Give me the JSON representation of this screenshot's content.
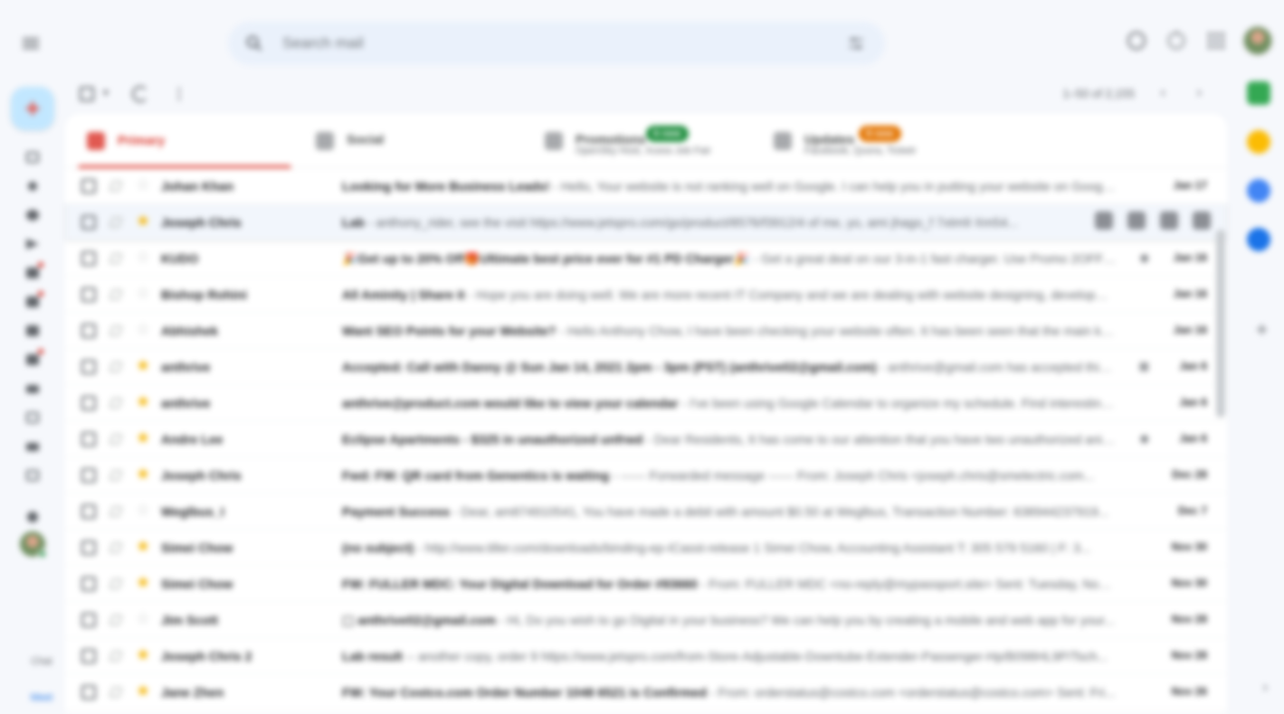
{
  "search": {
    "placeholder": "Search mail"
  },
  "toolbar": {
    "range": "1–50 of 2,155",
    "more": "⋮",
    "prev": "‹",
    "next": "›"
  },
  "rail": {
    "small_label": "Chat",
    "link_label": "Meet"
  },
  "tabs": [
    {
      "label": "Primary",
      "sub": "",
      "badge": "",
      "badge_color": "",
      "active": true
    },
    {
      "label": "Social",
      "sub": "",
      "badge": "",
      "badge_color": "",
      "active": false
    },
    {
      "label": "Promotions",
      "sub": "OpenSky Host, Xcess Job Fair",
      "badge": "6 new",
      "badge_color": "#1e8e3e",
      "active": false
    },
    {
      "label": "Updates",
      "sub": "Facebook, Quora, Ticketr",
      "badge": "8 new",
      "badge_color": "#e37400",
      "active": false
    }
  ],
  "colors": {
    "accent": "#d93025",
    "star": "#f4b400",
    "compose": "#c2e7ff"
  },
  "emails": [
    {
      "sender": "Johan Khan",
      "subject": "Looking for More Business Leads!",
      "snippet": " - Hello, Your website is not ranking well on Google. I can help you in putting your website on Google's first page",
      "date": "Jan 17",
      "starred": false,
      "hover": false,
      "attach": ""
    },
    {
      "sender": "Joseph Chris",
      "subject": "Lab",
      "snippet": " - anthony_rider, see the visit https://www.jetspro.com/go/product/8576/f3912/4 of me, yo, ami jhago_f 7xtm9 Xm54...",
      "date": "",
      "starred": true,
      "hover": true,
      "attach": ""
    },
    {
      "sender": "KUDO",
      "subject": "🎉Get up to 20% Off🎁Ultimate best price ever for #1 PD Charger🎉",
      "snippet": " - Get a great deal on our 3-in-1 fast charger. Use Promo 2OFF / 20...",
      "date": "Jan 16",
      "starred": false,
      "hover": false,
      "attach": "◉"
    },
    {
      "sender": "Bishop Rohini",
      "subject": "All Aminity | Share it",
      "snippet": " - Hope you are doing well. We are more recent IT Company and we are dealing with website designing, developme...",
      "date": "Jan 16",
      "starred": false,
      "hover": false,
      "attach": ""
    },
    {
      "sender": "Abhishek",
      "subject": "Want SEO Points for your Website?",
      "snippet": " - Hello Anthony Chow, I have been checking your website often. It has been seen that the main key...",
      "date": "Jan 16",
      "starred": false,
      "hover": false,
      "attach": ""
    },
    {
      "sender": "anthrive",
      "subject": "Accepted: Call with Danny @ Sun Jan 14, 2021 2pm - 3pm (PST) (anthrive02@gmail.com)",
      "snippet": " - anthrive@gmail.com has accepted this i...",
      "date": "Jan 6",
      "starred": true,
      "hover": false,
      "attach": "▦"
    },
    {
      "sender": "anthrive",
      "subject": "anthrive@product.com would like to view your calendar",
      "snippet": " - I've been using Google Calendar to organize my schedule. Find interesting at...",
      "date": "Jan 6",
      "starred": true,
      "hover": false,
      "attach": ""
    },
    {
      "sender": "Andre Lee",
      "subject": "Eclipse Apartments - $325 in unauthorized unfrwd",
      "snippet": " - Dear Residents, It has come to our attention that you have two unauthorized anima...",
      "date": "Jan 6",
      "starred": true,
      "hover": false,
      "attach": "◉"
    },
    {
      "sender": "Joseph Chris",
      "subject": "Fwd: FW: QR card from Genentics is waiting",
      "snippet": " - ------ Forwarded message ------ From: Joseph Chris <joseph.chris@smelectric.com...",
      "date": "Dec 28",
      "starred": true,
      "hover": false,
      "attach": ""
    },
    {
      "sender": "Weglbus_I",
      "subject": "Payment Success",
      "snippet": " - Dear, am874910541, You have made a debit with amount $0.50 at Weglbus, Transaction Number: 638944237919...",
      "date": "Dec 7",
      "starred": false,
      "hover": false,
      "attach": ""
    },
    {
      "sender": "Simei Chow",
      "subject": "(no subject)",
      "snippet": " - http://www.tiller.com/downloads/binding-ep-ICasst-release 1 Simei Chow, Accounting Assistant T: 305 579 5160 | F: 3...",
      "date": "Nov 30",
      "starred": true,
      "hover": false,
      "attach": ""
    },
    {
      "sender": "Simei Chow",
      "subject": "FW: FULLER MDC: Your Digital Download for Order #93660",
      "snippet": " - From: FULLER MDC <no-reply@mypassport.site> Sent: Tuesday, Nove...",
      "date": "Nov 30",
      "starred": true,
      "hover": false,
      "attach": ""
    },
    {
      "sender": "Jim Scott",
      "subject": "⬚ anthrive02@gmail.com",
      "snippet": " - Hi, Do you wish to go Digital in your business? We can help you by creating a mobile and web app for your...",
      "date": "Nov 28",
      "starred": false,
      "hover": false,
      "attach": ""
    },
    {
      "sender": "Joseph Chris 2",
      "subject": "Lab result",
      "snippet": " -- another copy, order 9 https://www.jetspro.com/from-Store-Adjustable-Downtube-Extender-Passenger-Hp/B098HL9P/Tsch...",
      "date": "Nov 28",
      "starred": true,
      "hover": false,
      "attach": ""
    },
    {
      "sender": "Jane Zhen",
      "subject": "FW: Your Costco.com Order Number 1048 6521 is Confirmed",
      "snippet": " - From: orderstatus@costco.com <orderstatus@costco.com> Sent: Fri...",
      "date": "Nov 26",
      "starred": true,
      "hover": false,
      "attach": ""
    }
  ]
}
